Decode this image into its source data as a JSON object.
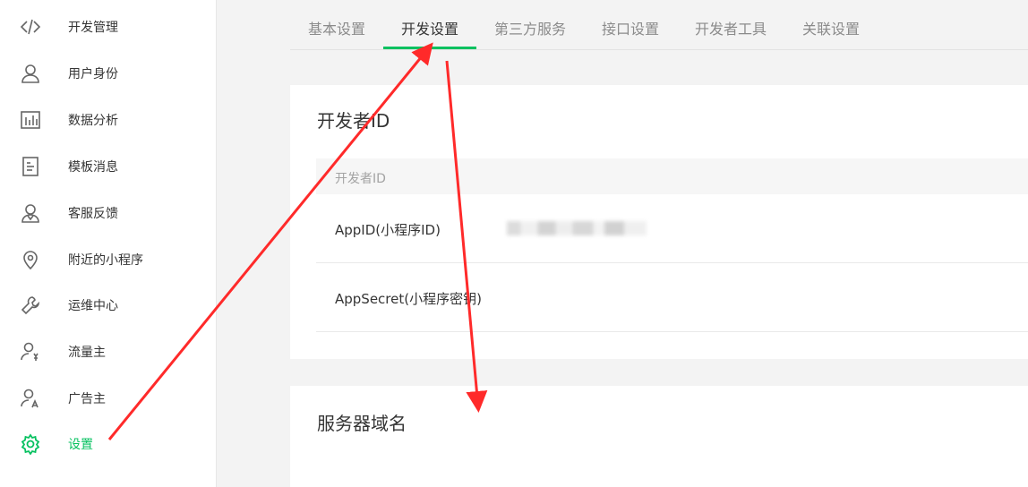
{
  "sidebar": {
    "items": [
      {
        "label": "开发管理",
        "icon": "code-icon"
      },
      {
        "label": "用户身份",
        "icon": "user-icon"
      },
      {
        "label": "数据分析",
        "icon": "bar-chart-icon"
      },
      {
        "label": "模板消息",
        "icon": "document-icon"
      },
      {
        "label": "客服反馈",
        "icon": "support-user-icon"
      },
      {
        "label": "附近的小程序",
        "icon": "location-pin-icon"
      },
      {
        "label": "运维中心",
        "icon": "wrench-icon"
      },
      {
        "label": "流量主",
        "icon": "user-yen-icon"
      },
      {
        "label": "广告主",
        "icon": "user-ad-icon"
      },
      {
        "label": "设置",
        "icon": "gear-icon",
        "active": true
      }
    ]
  },
  "tabs": [
    {
      "label": "基本设置"
    },
    {
      "label": "开发设置",
      "active": true
    },
    {
      "label": "第三方服务"
    },
    {
      "label": "接口设置"
    },
    {
      "label": "开发者工具"
    },
    {
      "label": "关联设置"
    }
  ],
  "developer_id": {
    "title": "开发者ID",
    "table_header": "开发者ID",
    "rows": [
      {
        "key": "AppID(小程序ID)"
      },
      {
        "key": "AppSecret(小程序密钥)"
      }
    ]
  },
  "server_domain": {
    "title": "服务器域名"
  },
  "colors": {
    "accent": "#07c160",
    "annotation_arrow": "#ff2a2a"
  }
}
